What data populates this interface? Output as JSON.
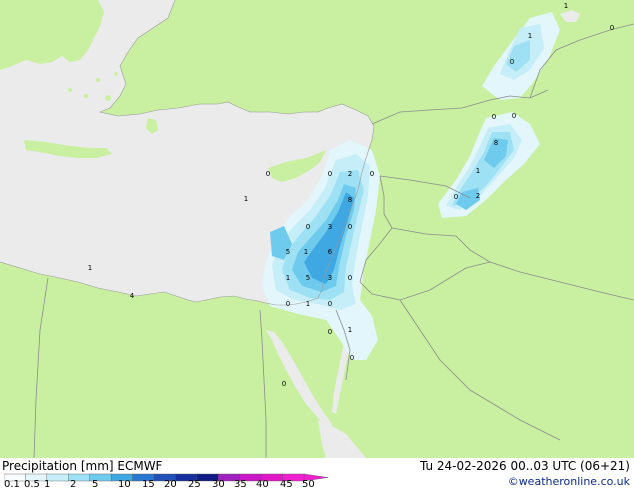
{
  "footer": {
    "title": "Precipitation [mm]  ECMWF",
    "datetime": "Tu 24-02-2026 00..03 UTC (06+21)",
    "credit": "©weatheronline.co.uk"
  },
  "legend": {
    "labels": [
      "0.1",
      "0.5",
      "1",
      "2",
      "5",
      "10",
      "15",
      "20",
      "25",
      "30",
      "35",
      "40",
      "45",
      "50"
    ],
    "colors": [
      "#f8fcfe",
      "#e2f6fb",
      "#c6eef8",
      "#9fe1f4",
      "#6ecbee",
      "#3fa8e3",
      "#2878d2",
      "#2050b8",
      "#17309e",
      "#101c86",
      "#a020c0",
      "#c818c8",
      "#e018c8",
      "#f020d0"
    ]
  },
  "colors": {
    "sea": "#ebebeb",
    "land": "#c8f0a0",
    "border": "#8c8c8c"
  },
  "map_labels": [
    "1",
    "1",
    "0",
    "0",
    "0",
    "0",
    "8",
    "1",
    "0",
    "2",
    "0",
    "0",
    "2",
    "0",
    "8",
    "1",
    "0",
    "3",
    "0",
    "5",
    "1",
    "6",
    "1",
    "5",
    "3",
    "0",
    "1",
    "4",
    "0",
    "1",
    "0",
    "1",
    "0",
    "0",
    "0"
  ]
}
